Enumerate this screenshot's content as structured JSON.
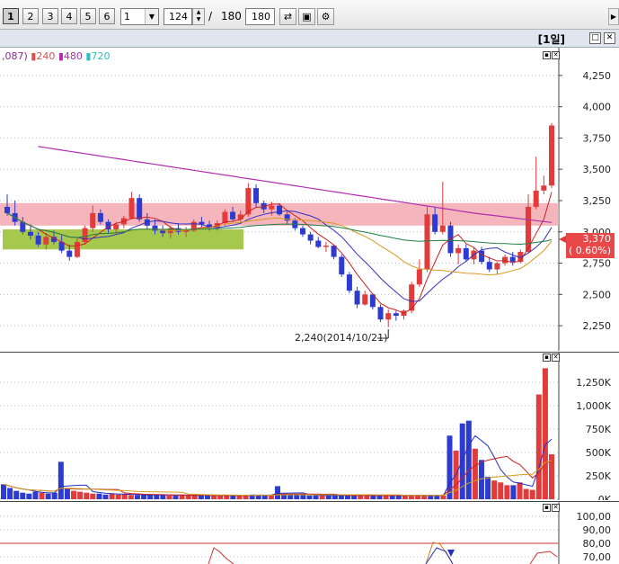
{
  "toolbar": {
    "tabs": [
      "1",
      "2",
      "3",
      "4",
      "5",
      "6"
    ],
    "period_select": "1",
    "position": "124",
    "slash": "/",
    "total": "180",
    "count_input": "180"
  },
  "window": {
    "period_label": "[1일]"
  },
  "legend": {
    "prefix": ",087)",
    "ma240": "240",
    "ma480": "480",
    "ma720": "720"
  },
  "colors": {
    "up": "#e23b3b",
    "down": "#2e3bd1",
    "band_pink": "#f2a8b0",
    "band_green": "#9cc23a",
    "ma240": "#e05050",
    "ma480": "#b02fb0",
    "ma720": "#2cc0c0"
  },
  "price_axis": [
    "4,250",
    "4,000",
    "3,750",
    "3,500",
    "3,250",
    "3,000",
    "2,750",
    "2,500",
    "2,250"
  ],
  "current_price": {
    "value": "3,370",
    "change": "( 0.60%)"
  },
  "low_annotation": "2,240(2014/10/21)",
  "volume_axis": [
    "1,250K",
    "1,000K",
    "750K",
    "500K",
    "250K",
    "0K"
  ],
  "osc_axis": [
    "100,00",
    "90,00",
    "80,00",
    "70,00"
  ],
  "chart_data": {
    "type": "candlestick",
    "price_range": [
      2100,
      4400
    ],
    "candles": [
      [
        3200,
        3300,
        3130,
        3150
      ],
      [
        3150,
        3250,
        3050,
        3080
      ],
      [
        3080,
        3120,
        2980,
        3000
      ],
      [
        3000,
        3060,
        2940,
        2970
      ],
      [
        2970,
        3000,
        2880,
        2900
      ],
      [
        2900,
        2990,
        2860,
        2960
      ],
      [
        2960,
        3010,
        2900,
        2920
      ],
      [
        2920,
        2980,
        2830,
        2850
      ],
      [
        2850,
        2900,
        2770,
        2800
      ],
      [
        2800,
        2950,
        2790,
        2920
      ],
      [
        2920,
        3050,
        2900,
        3030
      ],
      [
        3030,
        3210,
        3000,
        3150
      ],
      [
        3150,
        3180,
        3060,
        3080
      ],
      [
        3080,
        3100,
        2990,
        3020
      ],
      [
        3020,
        3080,
        2980,
        3060
      ],
      [
        3060,
        3130,
        3030,
        3110
      ],
      [
        3110,
        3320,
        3100,
        3270
      ],
      [
        3270,
        3300,
        3080,
        3100
      ],
      [
        3100,
        3150,
        3020,
        3050
      ],
      [
        3050,
        3100,
        2980,
        3010
      ],
      [
        3010,
        3050,
        2960,
        2990
      ],
      [
        2990,
        3050,
        2950,
        3030
      ],
      [
        3030,
        3070,
        2980,
        3000
      ],
      [
        3000,
        3040,
        2960,
        3010
      ],
      [
        3010,
        3100,
        3000,
        3080
      ],
      [
        3080,
        3120,
        3040,
        3060
      ],
      [
        3060,
        3090,
        3010,
        3030
      ],
      [
        3030,
        3090,
        3010,
        3070
      ],
      [
        3070,
        3180,
        3050,
        3160
      ],
      [
        3160,
        3200,
        3080,
        3100
      ],
      [
        3100,
        3170,
        3070,
        3140
      ],
      [
        3140,
        3390,
        3120,
        3350
      ],
      [
        3350,
        3380,
        3200,
        3230
      ],
      [
        3230,
        3250,
        3150,
        3180
      ],
      [
        3180,
        3240,
        3130,
        3210
      ],
      [
        3210,
        3230,
        3130,
        3140
      ],
      [
        3140,
        3160,
        3060,
        3090
      ],
      [
        3090,
        3110,
        3010,
        3030
      ],
      [
        3030,
        3050,
        2960,
        2980
      ],
      [
        2980,
        3000,
        2900,
        2930
      ],
      [
        2930,
        2960,
        2870,
        2880
      ],
      [
        2880,
        2920,
        2840,
        2890
      ],
      [
        2890,
        2900,
        2780,
        2800
      ],
      [
        2800,
        2820,
        2640,
        2660
      ],
      [
        2660,
        2680,
        2510,
        2530
      ],
      [
        2530,
        2560,
        2390,
        2420
      ],
      [
        2420,
        2530,
        2410,
        2500
      ],
      [
        2500,
        2510,
        2380,
        2400
      ],
      [
        2400,
        2420,
        2280,
        2300
      ],
      [
        2300,
        2380,
        2240,
        2350
      ],
      [
        2350,
        2370,
        2290,
        2330
      ],
      [
        2330,
        2380,
        2300,
        2370
      ],
      [
        2370,
        2600,
        2350,
        2580
      ],
      [
        2580,
        2780,
        2560,
        2700
      ],
      [
        2700,
        3200,
        2680,
        3140
      ],
      [
        3140,
        3200,
        2980,
        3000
      ],
      [
        3000,
        3400,
        2980,
        3050
      ],
      [
        3050,
        3080,
        2800,
        2830
      ],
      [
        2830,
        2900,
        2740,
        2870
      ],
      [
        2870,
        2900,
        2760,
        2780
      ],
      [
        2780,
        2880,
        2740,
        2850
      ],
      [
        2850,
        2880,
        2740,
        2760
      ],
      [
        2760,
        2800,
        2680,
        2700
      ],
      [
        2700,
        2760,
        2660,
        2750
      ],
      [
        2750,
        2820,
        2730,
        2800
      ],
      [
        2800,
        2840,
        2730,
        2760
      ],
      [
        2760,
        2860,
        2750,
        2840
      ],
      [
        2840,
        3300,
        2830,
        3200
      ],
      [
        3200,
        3600,
        3180,
        3330
      ],
      [
        3330,
        3450,
        3300,
        3370
      ],
      [
        3370,
        3870,
        3350,
        3850
      ]
    ],
    "volumes": [
      160,
      120,
      90,
      70,
      60,
      80,
      70,
      60,
      70,
      400,
      110,
      90,
      80,
      70,
      60,
      60,
      50,
      60,
      50,
      55,
      45,
      45,
      45,
      45,
      50,
      45,
      40,
      40,
      45,
      40,
      40,
      40,
      40,
      40,
      40,
      40,
      40,
      40,
      45,
      50,
      45,
      40,
      40,
      140,
      60,
      50,
      45,
      45,
      40,
      40,
      40,
      40,
      40,
      40,
      40,
      40,
      40,
      40,
      40,
      40,
      40,
      40,
      40,
      40,
      40,
      40,
      40,
      40,
      40,
      40,
      680,
      520,
      810,
      840,
      540,
      420,
      240,
      200,
      180,
      150,
      150,
      180,
      110,
      100,
      1120,
      1400,
      480
    ]
  }
}
